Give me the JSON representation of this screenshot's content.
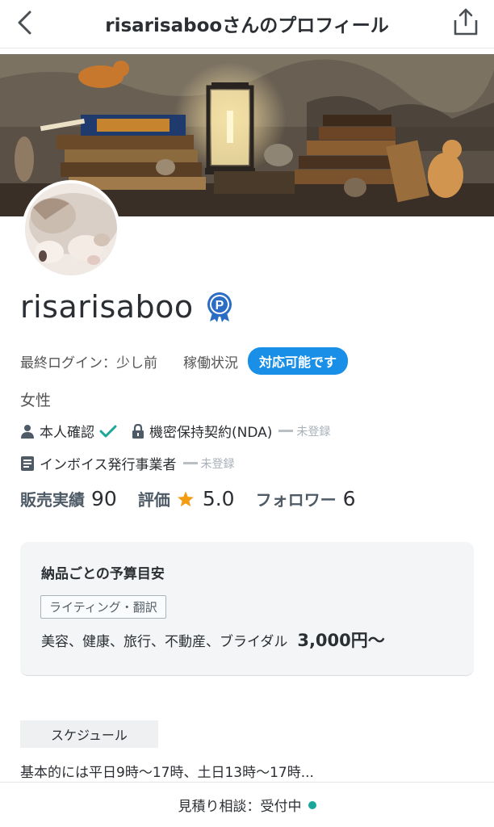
{
  "header": {
    "title": "risarisabooさんのプロフィール",
    "back_icon": "chevron-left-icon",
    "share_icon": "share-icon"
  },
  "profile": {
    "name": "risarisaboo",
    "badge_icon": "p-award-badge-icon",
    "last_login_label": "最終ログイン：少し前",
    "status_label": "稼働状況",
    "status_value": "対応可能です",
    "gender": "女性"
  },
  "verifications": {
    "identity_label": "本人確認",
    "nda_label": "機密保持契約(NDA)",
    "nda_status": "未登録",
    "invoice_label": "インボイス発行事業者",
    "invoice_status": "未登録"
  },
  "stats": {
    "sales_label": "販売実績",
    "sales_value": "90",
    "rating_label": "評価",
    "rating_value": "5.0",
    "followers_label": "フォロワー",
    "followers_value": "6"
  },
  "budget": {
    "title": "納品ごとの予算目安",
    "tag": "ライティング・翻訳",
    "categories": "美容、健康、旅行、不動産、ブライダル",
    "price": "3,000円〜"
  },
  "schedule": {
    "label": "スケジュール",
    "text": "基本的には平日9時〜17時、土日13時〜17時..."
  },
  "footer": {
    "text": "見積り相談：受付中"
  },
  "colors": {
    "accent_blue": "#1a8fe8",
    "check_green": "#1aa79a",
    "star_orange": "#f39c12",
    "online_dot": "#1aa79a"
  }
}
